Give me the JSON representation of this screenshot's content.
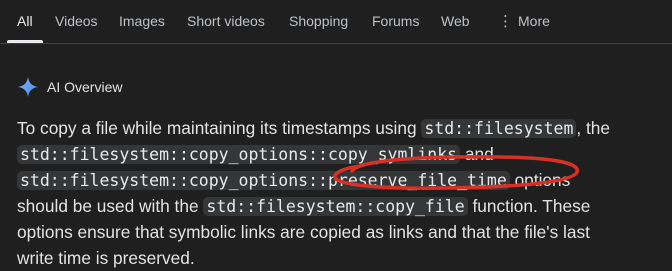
{
  "tabs": [
    {
      "label": "All"
    },
    {
      "label": "Videos"
    },
    {
      "label": "Images"
    },
    {
      "label": "Short videos"
    },
    {
      "label": "Shopping"
    },
    {
      "label": "Forums"
    },
    {
      "label": "Web"
    },
    {
      "label": "More"
    }
  ],
  "more_icon": "vertical-dots-icon",
  "ai_overview": {
    "icon": "sparkle-icon",
    "title": "AI Overview",
    "paragraph": {
      "t1": "To copy a file while maintaining its timestamps using ",
      "c1": "std::filesystem",
      "t2": ", the",
      "c2": "std::filesystem::copy_options::copy_symlinks",
      "t3": " and",
      "c3": "std::filesystem::copy_options::preserve_file_time",
      "t4": " options",
      "t5": "should be used with the ",
      "c4": "std::filesystem::copy_file",
      "t6": " function. These",
      "t7": "options ensure that symbolic links are copied as links and that the file's last",
      "t8": "write time is preserved."
    }
  },
  "colors": {
    "background": "#1f1f1f",
    "text": "#e3e3e3",
    "code_background": "#353638",
    "annotation": "#d93025",
    "sparkle": "#8ab4f8"
  },
  "annotation": "red-circle-around-preserve_file_time"
}
